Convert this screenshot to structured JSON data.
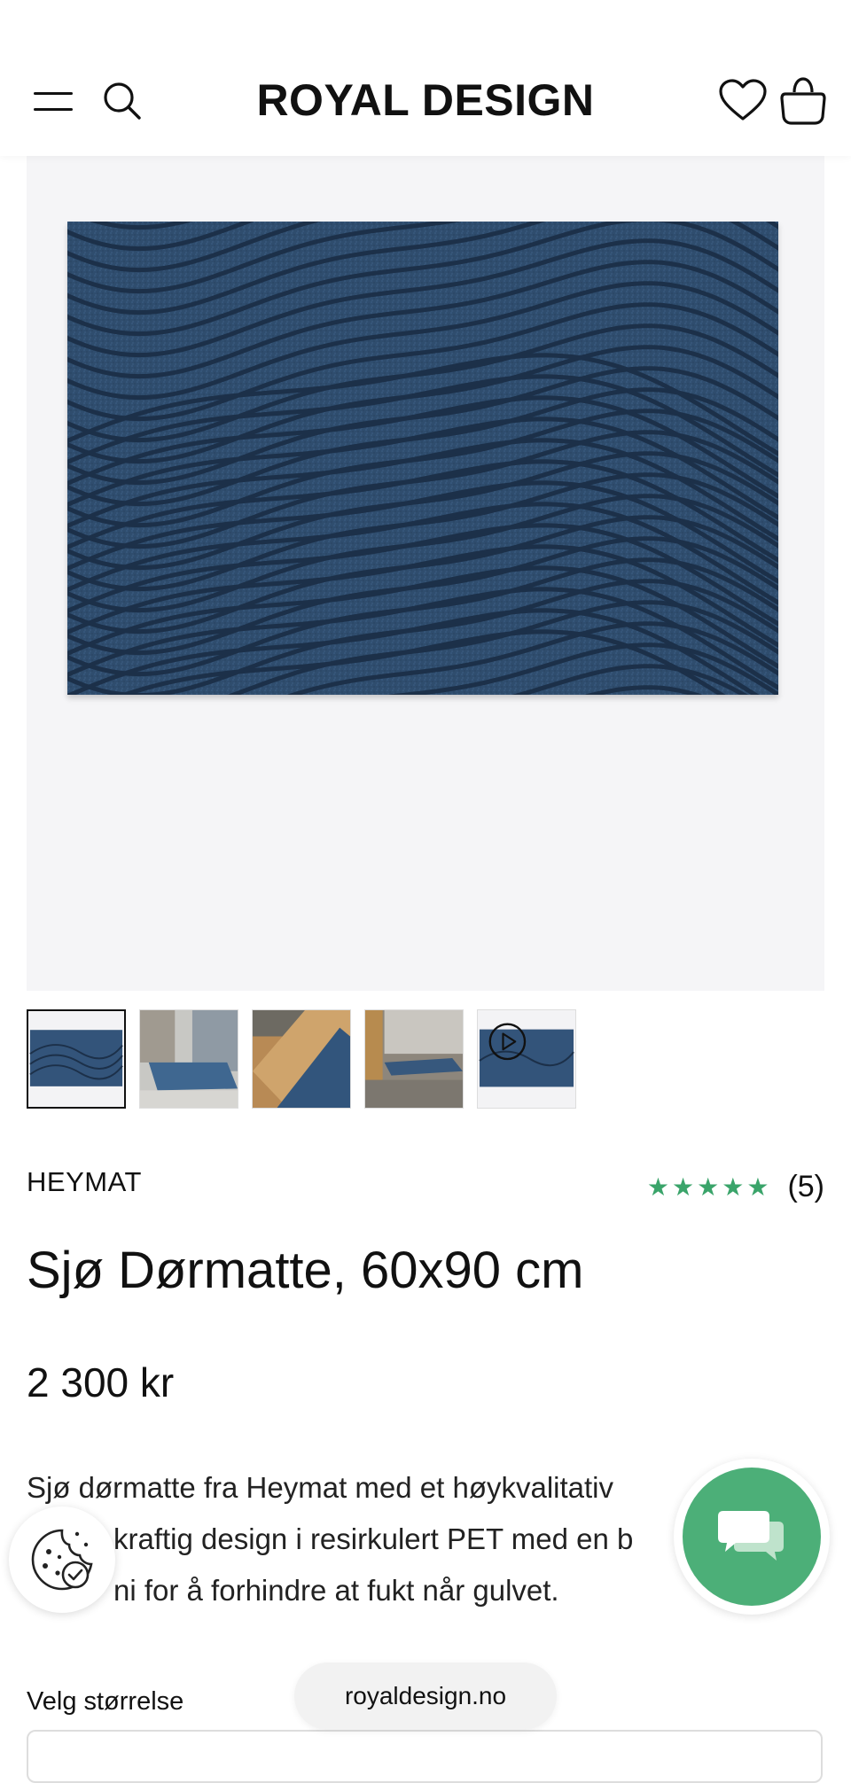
{
  "header": {
    "logo": "ROYAL DESIGN",
    "icons": [
      "menu-icon",
      "search-icon",
      "heart-icon",
      "bag-icon"
    ]
  },
  "gallery": {
    "thumbnails": [
      {
        "name": "thumbnail-mat-top",
        "active": true
      },
      {
        "name": "thumbnail-mat-doorway",
        "active": false
      },
      {
        "name": "thumbnail-mat-wood-floor",
        "active": false
      },
      {
        "name": "thumbnail-mat-entrance",
        "active": false
      },
      {
        "name": "thumbnail-video",
        "active": false
      }
    ],
    "mat_color": "#2f4d6e"
  },
  "product": {
    "brand": "HEYMAT",
    "rating_stars": "★★★★★",
    "rating_value": 5,
    "review_count": "(5)",
    "title": "Sjø Dørmatte, 60x90 cm",
    "price": "2 300 kr",
    "description_lines": [
      "Sjø dørmatte fra Heymat med et høykvalitativ",
      "kraftig design i resirkulert PET med en b",
      "ni for å forhindre at fukt når gulvet."
    ]
  },
  "size": {
    "label": "Velg størrelse"
  },
  "browser": {
    "url": "royaldesign.no"
  },
  "colors": {
    "accent_green": "#3aa46a",
    "chat_green": "#4caf78"
  }
}
